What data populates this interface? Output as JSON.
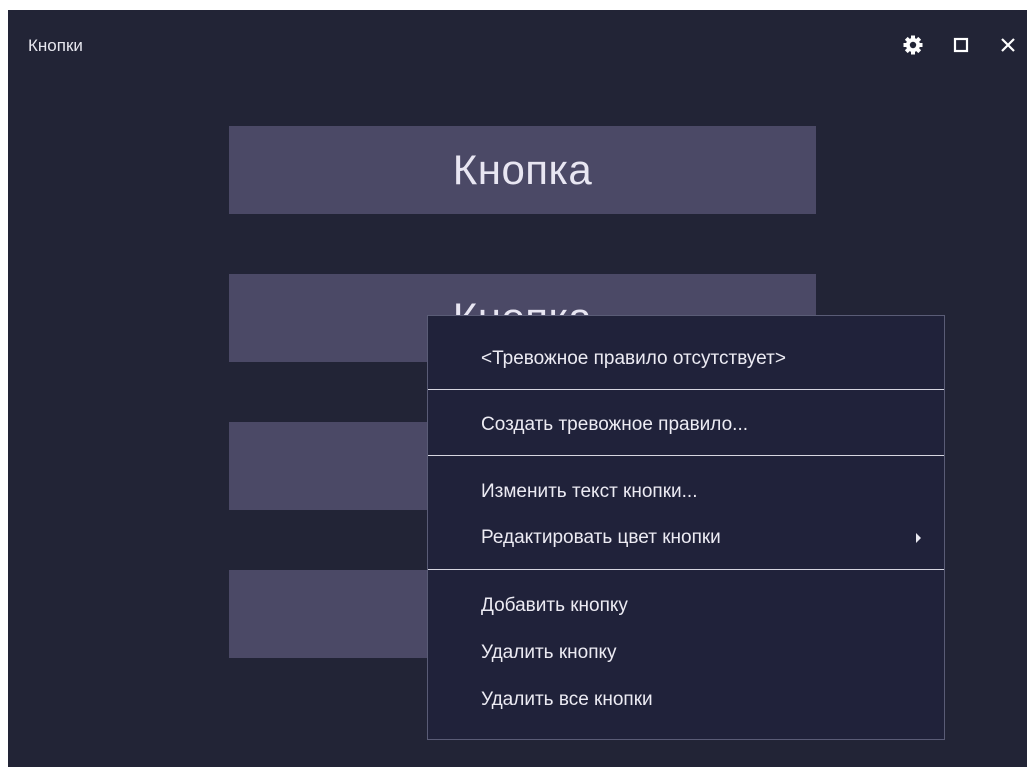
{
  "window": {
    "title": "Кнопки",
    "controls": {
      "settings_icon": "gear-icon",
      "maximize_icon": "maximize-icon",
      "close_icon": "close-icon"
    }
  },
  "buttons": [
    {
      "label": "Кнопка"
    },
    {
      "label": "Кнопка"
    },
    {
      "label": ""
    },
    {
      "label": ""
    }
  ],
  "context_menu": {
    "items": [
      {
        "label": "<Тревожное правило отсутствует>"
      },
      {
        "label": "Создать тревожное правило..."
      },
      {
        "label": "Изменить текст кнопки..."
      },
      {
        "label": "Редактировать цвет кнопки",
        "submenu": true
      },
      {
        "label": "Добавить кнопку"
      },
      {
        "label": "Удалить кнопку"
      },
      {
        "label": "Удалить все кнопки"
      }
    ]
  },
  "colors": {
    "background": "#222436",
    "button": "#4b4966",
    "menu_background": "#20223a",
    "text": "#ecebf3"
  }
}
